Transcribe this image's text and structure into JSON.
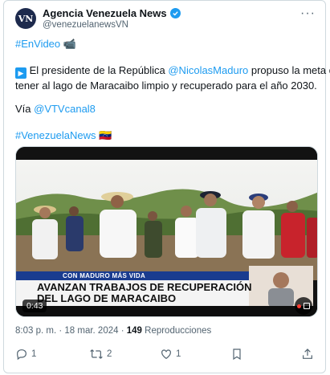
{
  "author": {
    "name": "Agencia Venezuela News",
    "handle": "@venezuelanewsVN",
    "avatar_initials": "VN"
  },
  "tweet": {
    "hashtag_envideo": "#EnVideo",
    "envideo_emoji": "📹",
    "play_emoji": "▶",
    "line1_pre": "El presidente de la República ",
    "mention1": "@NicolasMaduro",
    "line1_post": " propuso la meta de",
    "line2": "tener al lago de Maracaibo limpio y recuperado para el año 2030.",
    "via_pre": "Vía ",
    "mention2": "@VTVcanal8",
    "hashtag_news": "#VenezuelaNews",
    "flag_emoji": "🇻🇪"
  },
  "video": {
    "banner_small": "CON MADURO MÁS VIDA",
    "banner_line1": "AVANZAN TRABAJOS DE RECUPERACIÓN",
    "banner_line2": "DEL LAGO DE MARACAIBO",
    "duration": "0:43"
  },
  "meta": {
    "time": "8:03 p. m.",
    "sep1": " · ",
    "date": "18 mar. 2024",
    "sep2": " · ",
    "views": "149",
    "views_label": " Reproducciones"
  },
  "actions": {
    "replies": "1",
    "retweets": "2",
    "likes": "1"
  },
  "colors": {
    "accent": "#1d9bf0",
    "text": "#0f1419",
    "muted": "#536471",
    "border": "#cfd9de"
  }
}
